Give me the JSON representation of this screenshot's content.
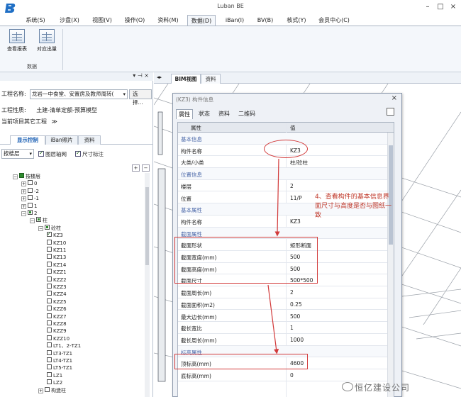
{
  "app": {
    "title": "Luban BE"
  },
  "menu": [
    {
      "label": "系统(S)"
    },
    {
      "label": "沙盘(X)"
    },
    {
      "label": "视图(V)"
    },
    {
      "label": "操作(O)"
    },
    {
      "label": "资料(M)"
    },
    {
      "label": "数据(D)"
    },
    {
      "label": "iBan(I)"
    },
    {
      "label": "BV(B)"
    },
    {
      "label": "核式(Y)"
    },
    {
      "label": "会员中心(C)"
    }
  ],
  "ribbon": {
    "buttons": [
      {
        "label": "查看报表"
      },
      {
        "label": "对应出量"
      }
    ],
    "group": "数据"
  },
  "project": {
    "name_label": "工程名称:",
    "name_value": "龙岩一中食堂、安置房及教师周转(",
    "choose_btn": "选择...",
    "nature_label": "工程性质:",
    "nature_value": "土建-清单定额-预算模型",
    "current_label": "当前项目其它工程"
  },
  "left_tabs": [
    {
      "label": "显示控制"
    },
    {
      "label": "iBan照片"
    },
    {
      "label": "资料"
    }
  ],
  "filter": {
    "combo": "按楼层",
    "check1": "图层轴网",
    "check2": "尺寸标注"
  },
  "tree": [
    {
      "label": "按楼层",
      "lvl": 0,
      "exp": "−",
      "cb": "full"
    },
    {
      "label": "0",
      "lvl": 1,
      "exp": "+",
      "cb": ""
    },
    {
      "label": "-2",
      "lvl": 1,
      "exp": "+",
      "cb": ""
    },
    {
      "label": "-1",
      "lvl": 1,
      "exp": "+",
      "cb": ""
    },
    {
      "label": "1",
      "lvl": 1,
      "exp": "+",
      "cb": ""
    },
    {
      "label": "2",
      "lvl": 1,
      "exp": "−",
      "cb": "part"
    },
    {
      "label": "柱",
      "lvl": 2,
      "exp": "−",
      "cb": "part"
    },
    {
      "label": "砼柱",
      "lvl": 3,
      "exp": "−",
      "cb": "part"
    },
    {
      "label": "KZ3",
      "lvl": 4,
      "exp": "",
      "cb": "tick"
    },
    {
      "label": "KZ10",
      "lvl": 4,
      "exp": "",
      "cb": ""
    },
    {
      "label": "KZ11",
      "lvl": 4,
      "exp": "",
      "cb": ""
    },
    {
      "label": "KZ13",
      "lvl": 4,
      "exp": "",
      "cb": ""
    },
    {
      "label": "KZ14",
      "lvl": 4,
      "exp": "",
      "cb": ""
    },
    {
      "label": "KZZ1",
      "lvl": 4,
      "exp": "",
      "cb": ""
    },
    {
      "label": "KZZ2",
      "lvl": 4,
      "exp": "",
      "cb": ""
    },
    {
      "label": "KZZ3",
      "lvl": 4,
      "exp": "",
      "cb": ""
    },
    {
      "label": "KZZ4",
      "lvl": 4,
      "exp": "",
      "cb": ""
    },
    {
      "label": "KZZ5",
      "lvl": 4,
      "exp": "",
      "cb": ""
    },
    {
      "label": "KZZ6",
      "lvl": 4,
      "exp": "",
      "cb": ""
    },
    {
      "label": "KZZ7",
      "lvl": 4,
      "exp": "",
      "cb": ""
    },
    {
      "label": "KZZ8",
      "lvl": 4,
      "exp": "",
      "cb": ""
    },
    {
      "label": "KZZ9",
      "lvl": 4,
      "exp": "",
      "cb": ""
    },
    {
      "label": "KZZ10",
      "lvl": 4,
      "exp": "",
      "cb": ""
    },
    {
      "label": "LT1、2-TZ1",
      "lvl": 4,
      "exp": "",
      "cb": ""
    },
    {
      "label": "LT3-TZ1",
      "lvl": 4,
      "exp": "",
      "cb": ""
    },
    {
      "label": "LT4-TZ1",
      "lvl": 4,
      "exp": "",
      "cb": ""
    },
    {
      "label": "LT5-TZ1",
      "lvl": 4,
      "exp": "",
      "cb": ""
    },
    {
      "label": "LZ1",
      "lvl": 4,
      "exp": "",
      "cb": ""
    },
    {
      "label": "LZ2",
      "lvl": 4,
      "exp": "",
      "cb": ""
    },
    {
      "label": "构造柱",
      "lvl": 3,
      "exp": "+",
      "cb": ""
    }
  ],
  "main_tabs": [
    {
      "label": "BIM视图"
    },
    {
      "label": "资料"
    }
  ],
  "dialog": {
    "title": "(KZ3) 构件信息",
    "tabs": [
      {
        "label": "属性"
      },
      {
        "label": "状态"
      },
      {
        "label": "资料"
      },
      {
        "label": "二维码"
      }
    ],
    "col_key": "属性",
    "col_val": "值",
    "rows": [
      {
        "k": "基本信息",
        "v": "",
        "section": true
      },
      {
        "k": "构件名称",
        "v": "KZ3"
      },
      {
        "k": "大类/小类",
        "v": "柱/砼柱"
      },
      {
        "k": "位置信息",
        "v": "",
        "section": true
      },
      {
        "k": "楼层",
        "v": "2"
      },
      {
        "k": "位置",
        "v": "11/P"
      },
      {
        "k": "基本属性",
        "v": "",
        "section": true
      },
      {
        "k": "构件名称",
        "v": "KZ3"
      },
      {
        "k": "截面属性",
        "v": "",
        "section": true
      },
      {
        "k": "截面形状",
        "v": "矩形断面"
      },
      {
        "k": "截面宽度(mm)",
        "v": "500"
      },
      {
        "k": "截面高度(mm)",
        "v": "500"
      },
      {
        "k": "截面尺寸",
        "v": "500*500"
      },
      {
        "k": "截面周长(m)",
        "v": "2"
      },
      {
        "k": "截面面积(m2)",
        "v": "0.25"
      },
      {
        "k": "最大边长(mm)",
        "v": "500"
      },
      {
        "k": "截长宽比",
        "v": "1"
      },
      {
        "k": "截长周长(mm)",
        "v": "1000"
      },
      {
        "k": "标高属性",
        "v": "",
        "section": true
      },
      {
        "k": "顶标高(mm)",
        "v": "4600"
      },
      {
        "k": "底标高(mm)",
        "v": "0"
      }
    ]
  },
  "annotation": {
    "note": "4、查看构件的基本信息界面尺寸与高度是否与图纸一致"
  },
  "watermark": {
    "text": "恒亿建设公司"
  },
  "colors": {
    "accent": "#1a5fb4",
    "annotation": "#d23a3a"
  }
}
